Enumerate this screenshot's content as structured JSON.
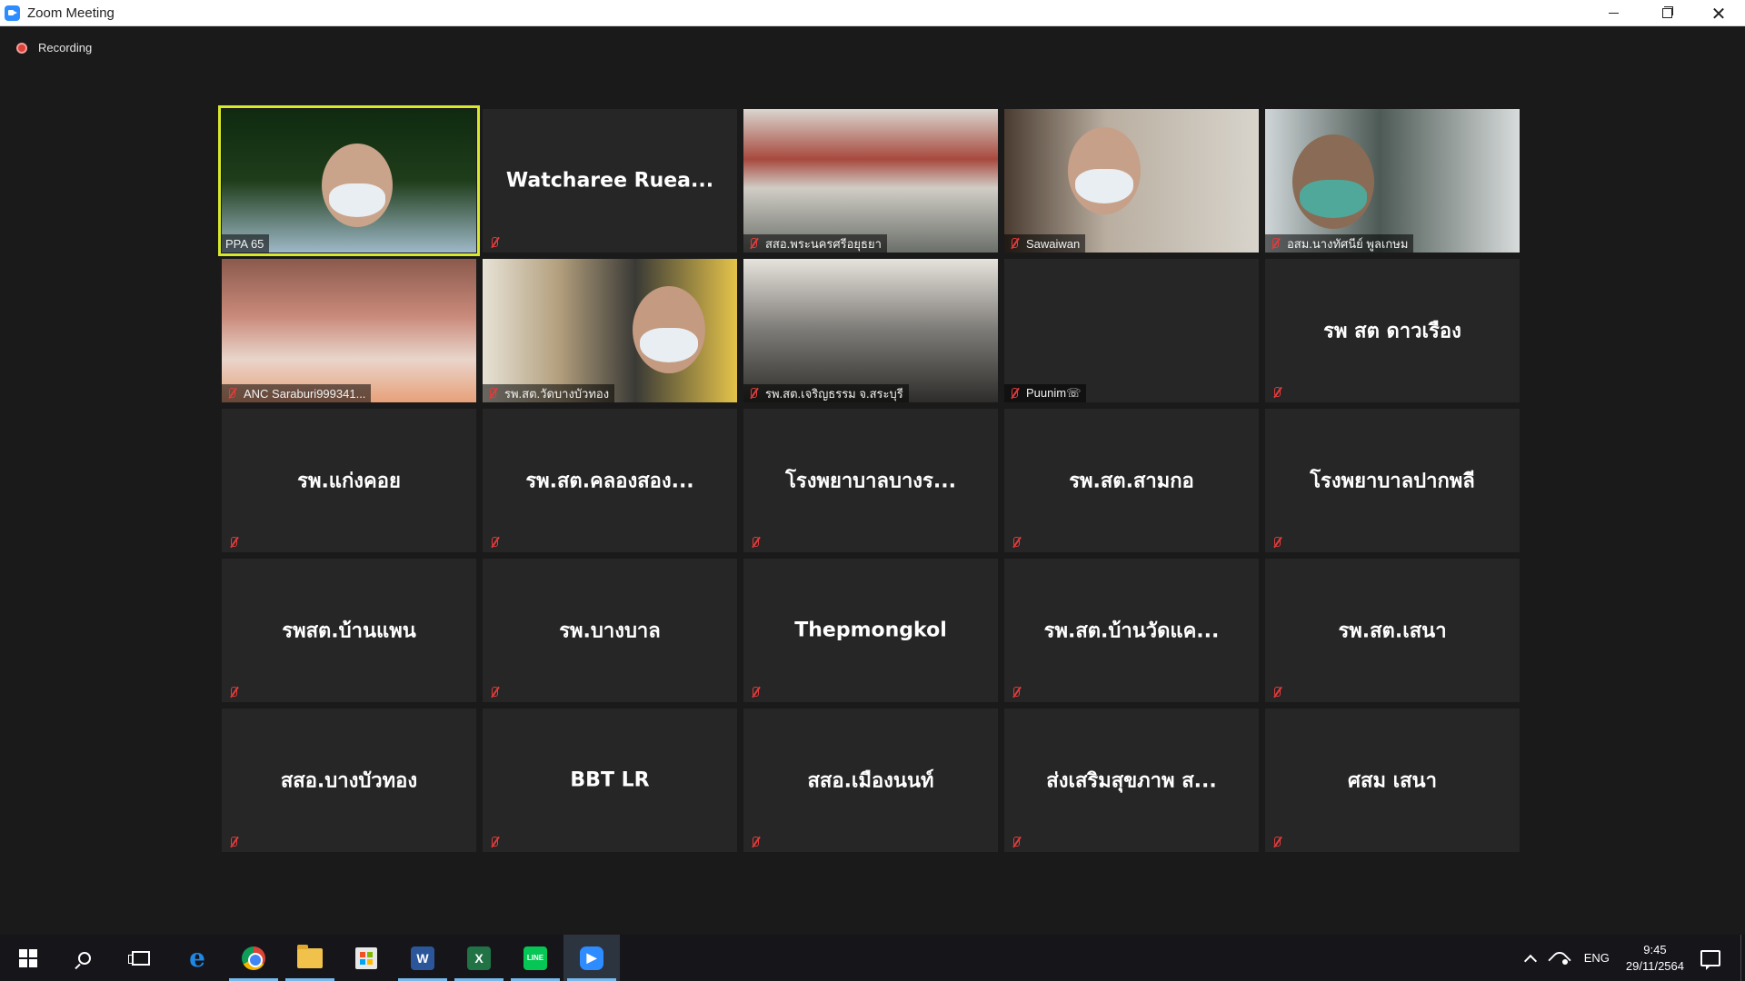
{
  "window": {
    "title": "Zoom Meeting",
    "icon": "zoom-app-icon",
    "controls": [
      "minimize",
      "restore",
      "close"
    ]
  },
  "recording": {
    "label": "Recording",
    "color": "#e0403a"
  },
  "active_speaker_color": "#d7e92a",
  "tiles": [
    {
      "name": "PPA 65",
      "video": true,
      "muted": false,
      "active": true
    },
    {
      "name": "Watcharee  Ruea...",
      "video": false,
      "muted": true,
      "show_label": false
    },
    {
      "name": "สสอ.พระนครศรีอยุธยา",
      "video": true,
      "muted": true
    },
    {
      "name": "Sawaiwan",
      "video": true,
      "muted": true
    },
    {
      "name": "อสม.นางทัศนีย์ พูลเกษม",
      "video": true,
      "muted": true
    },
    {
      "name": "ANC Saraburi999341...",
      "video": true,
      "muted": true
    },
    {
      "name": "รพ.สต.วัดบางบัวทอง",
      "video": true,
      "muted": true
    },
    {
      "name": "รพ.สต.เจริญธรรม จ.สระบุรี",
      "video": true,
      "muted": true
    },
    {
      "name": "Puunim☏",
      "video": false,
      "muted": true,
      "show_label": true,
      "blank": true
    },
    {
      "name": "รพ สต ดาวเรือง",
      "video": false,
      "muted": true
    },
    {
      "name": "รพ.แก่งคอย",
      "video": false,
      "muted": true
    },
    {
      "name": "รพ.สต.คลองสอง...",
      "video": false,
      "muted": true
    },
    {
      "name": "โรงพยาบาลบางร...",
      "video": false,
      "muted": true
    },
    {
      "name": "รพ.สต.สามกอ",
      "video": false,
      "muted": true
    },
    {
      "name": "โรงพยาบาลปากพลี",
      "video": false,
      "muted": true
    },
    {
      "name": "รพสต.บ้านแพน",
      "video": false,
      "muted": true
    },
    {
      "name": "รพ.บางบาล",
      "video": false,
      "muted": true
    },
    {
      "name": "Thepmongkol",
      "video": false,
      "muted": true
    },
    {
      "name": "รพ.สต.บ้านวัดแค...",
      "video": false,
      "muted": true
    },
    {
      "name": "รพ.สต.เสนา",
      "video": false,
      "muted": true
    },
    {
      "name": "สสอ.บางบัวทอง",
      "video": false,
      "muted": true
    },
    {
      "name": "BBT LR",
      "video": false,
      "muted": true
    },
    {
      "name": "สสอ.เมืองนนท์",
      "video": false,
      "muted": true
    },
    {
      "name": "ส่งเสริมสุขภาพ ส...",
      "video": false,
      "muted": true
    },
    {
      "name": "ศสม เสนา",
      "video": false,
      "muted": true
    }
  ],
  "taskbar": {
    "apps": [
      {
        "name": "start-button"
      },
      {
        "name": "search-button"
      },
      {
        "name": "task-view-button"
      },
      {
        "name": "edge-app",
        "running": false
      },
      {
        "name": "chrome-app",
        "running": true
      },
      {
        "name": "file-explorer-app",
        "running": true
      },
      {
        "name": "store-app",
        "running": false
      },
      {
        "name": "word-app",
        "running": true,
        "letter": "W",
        "color": "#2b579a"
      },
      {
        "name": "excel-app",
        "running": true,
        "letter": "X",
        "color": "#217346"
      },
      {
        "name": "line-app",
        "running": true,
        "letter": "LINE",
        "color": "#06c755"
      },
      {
        "name": "zoom-app",
        "running": true,
        "current": true,
        "color": "#2d8cff"
      }
    ],
    "tray": {
      "language": "ENG",
      "time": "9:45",
      "date": "29/11/2564"
    }
  }
}
